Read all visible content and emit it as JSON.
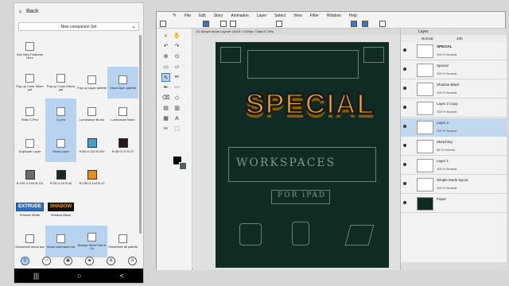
{
  "phone": {
    "back_label": "Back",
    "set_select": "New companion Set",
    "items": [
      {
        "label": "See New Features Here",
        "type": "icon"
      },
      {
        "label": "Pop up Color Slider pal",
        "type": "icon"
      },
      {
        "label": "Pop up Color Mixed pal",
        "type": "icon"
      },
      {
        "label": "Pop up Layer palette",
        "type": "icon"
      },
      {
        "label": "Show layer palette",
        "type": "icon",
        "selected": true
      },
      {
        "label": "Real G-Pen",
        "type": "icon"
      },
      {
        "label": "G-pen",
        "type": "icon",
        "selected": true
      },
      {
        "label": "Luminance Brush",
        "type": "icon"
      },
      {
        "label": "Luminance Neon",
        "type": "icon"
      },
      {
        "label": "Duplicate Layer",
        "type": "icon"
      },
      {
        "label": "Show Layer",
        "type": "icon",
        "selected": true
      },
      {
        "label": "R:66 G:162 B:205",
        "type": "swatch",
        "color": "#42a2cd"
      },
      {
        "label": "R:36 G:27 B:27",
        "type": "swatch",
        "color": "#241b1b"
      },
      {
        "label": "R:105 G:109 B:111",
        "type": "swatch",
        "color": "#696d6f"
      },
      {
        "label": "R:25 G:42 B:34",
        "type": "swatch",
        "color": "#192a22"
      },
      {
        "label": "R:236 G:142 B:12",
        "type": "swatch",
        "color": "#ec8e0c"
      },
      {
        "label": "Extrude White",
        "type": "logo",
        "logo": "EXTRUDE"
      },
      {
        "label": "Shadow Black",
        "type": "logo",
        "logo": "SHADOW"
      },
      {
        "label": "Show/hide menu bar",
        "type": "icon"
      },
      {
        "label": "Show command bar",
        "type": "icon",
        "selected": true
      },
      {
        "label": "Always Show Tab in Cu",
        "type": "icon",
        "selected": true
      },
      {
        "label": "Show/hide all palette",
        "type": "icon"
      }
    ],
    "bottom_icons": [
      "Q",
      "□",
      "▣",
      "■",
      "⊞",
      "⊟"
    ],
    "nav": [
      "|||",
      "○",
      "<"
    ]
  },
  "app": {
    "menu": [
      "File",
      "Edit",
      "Story",
      "Animation",
      "Layer",
      "Select",
      "View",
      "Filter",
      "Window",
      "Help"
    ],
    "doc_title": "01 Simple Mode Layout* (1620 x 2000px 72dpi 87.5%)",
    "canvas": {
      "headline": "SPECIAL",
      "sketch_text": "WORKSPACES",
      "sketch_sub": "FOR iPAD"
    },
    "layers_title": "Layer",
    "blend_mode": "Normal",
    "opacity": "100",
    "layers": [
      {
        "name": "SPECIAL",
        "sub": "100 % Normal",
        "bold": true
      },
      {
        "name": "Special",
        "sub": "100 % Normal"
      },
      {
        "name": "Shadow Black",
        "sub": "100 % Normal"
      },
      {
        "name": "Layer 2 Copy",
        "sub": "100 % Normal"
      },
      {
        "name": "Layer 2",
        "sub": "100 % Normal",
        "selected": true
      },
      {
        "name": "Sketching",
        "sub": "85 % Normal"
      },
      {
        "name": "Layer 1",
        "sub": "100 % Normal"
      },
      {
        "name": "Simple Mode layout",
        "sub": "100 % Normal"
      },
      {
        "name": "Paper",
        "sub": "",
        "dark": true
      }
    ]
  },
  "colors": {
    "accent": "#3b78c4",
    "selected_bg": "#b7d3ef",
    "canvas_bg": "#0f2b24",
    "headline": "#f8b023"
  }
}
